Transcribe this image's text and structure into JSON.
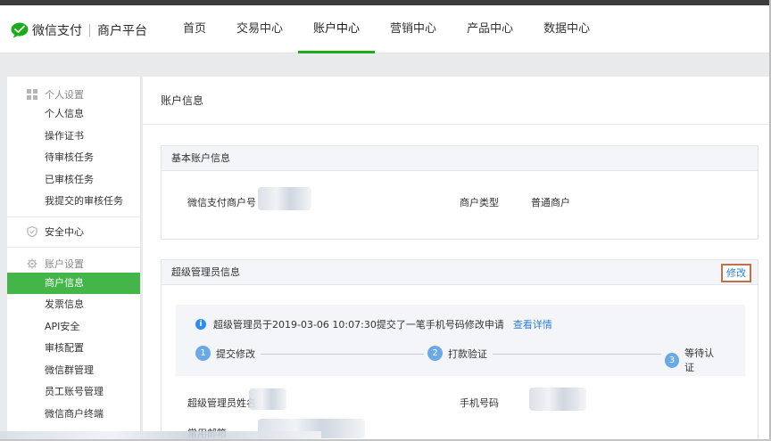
{
  "brand": {
    "name": "微信支付",
    "subtitle": "商户平台",
    "accent": "#1aad19"
  },
  "nav": [
    {
      "label": "首页",
      "active": false
    },
    {
      "label": "交易中心",
      "active": false
    },
    {
      "label": "账户中心",
      "active": true
    },
    {
      "label": "营销中心",
      "active": false
    },
    {
      "label": "产品中心",
      "active": false
    },
    {
      "label": "数据中心",
      "active": false
    }
  ],
  "sidebar": {
    "personal": {
      "title": "个人设置",
      "icon": "grid-icon",
      "items": [
        "个人信息",
        "操作证书",
        "待审核任务",
        "已审核任务",
        "我提交的审核任务"
      ]
    },
    "security": {
      "title": "安全中心",
      "icon": "shield-icon"
    },
    "account": {
      "title": "账户设置",
      "icon": "gear-icon",
      "items": [
        "商户信息",
        "发票信息",
        "API安全",
        "审核配置",
        "微信群管理",
        "员工账号管理",
        "微信商户终端"
      ],
      "active_index": 0
    }
  },
  "main": {
    "title": "账户信息",
    "basic": {
      "title": "基本账户信息",
      "merchant_id_label": "微信支付商户号",
      "merchant_type_label": "商户类型",
      "merchant_type_value": "普通商户"
    },
    "admin": {
      "title": "超级管理员信息",
      "edit_label": "修改",
      "notice": "超级管理员于2019-03-06 10:07:30提交了一笔手机号码修改申请",
      "detail_link": "查看详情",
      "steps": [
        {
          "num": "1",
          "label": "提交修改"
        },
        {
          "num": "2",
          "label": "打款验证"
        },
        {
          "num": "3",
          "label": "等待认证"
        }
      ],
      "name_label": "超级管理员姓名",
      "phone_label": "手机号码",
      "email_label": "常用邮箱"
    }
  }
}
